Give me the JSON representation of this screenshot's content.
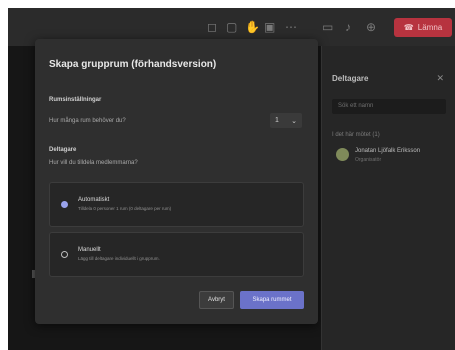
{
  "topbar": {
    "icons": [
      "camera-icon",
      "chat-icon",
      "hand-icon",
      "rooms-icon",
      "more-icon",
      "video-icon",
      "mic-icon",
      "share-icon"
    ],
    "leave_label": "Lämna"
  },
  "sidebar": {
    "title": "Deltagare",
    "search_placeholder": "Sök ett namn",
    "group_label": "I det här mötet (1)",
    "person_name": "Jonatan Ljöfalk Eriksson",
    "person_role": "Organisatör"
  },
  "modal": {
    "title": "Skapa grupprum (förhandsversion)",
    "room_settings_label": "Rumsinställningar",
    "rooms_question": "Hur många rum behöver du?",
    "rooms_count": "1",
    "participants_label": "Deltagare",
    "assign_question": "Hur vill du tilldela medlemmarna?",
    "options": [
      {
        "label": "Automatiskt",
        "description": "Tilldela 0 personer 1 rum (0 deltagare per rum)",
        "selected": true
      },
      {
        "label": "Manuellt",
        "description": "Lägg till deltagare individuellt i grupprum.",
        "selected": false
      }
    ],
    "cancel_label": "Avbryt",
    "create_label": "Skapa rummet"
  },
  "colors": {
    "accent": "#6b72c9",
    "leave": "#b7333f",
    "panel": "#2f2f2f",
    "background": "#1f1f1f"
  }
}
